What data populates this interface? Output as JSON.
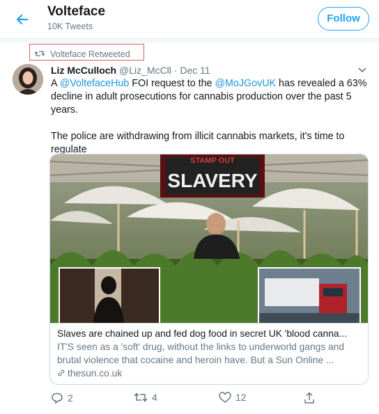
{
  "header": {
    "title": "Volteface",
    "subtitle": "10K Tweets",
    "follow_label": "Follow",
    "back_icon": "arrow-left-icon"
  },
  "retweet_context": "Volteface Retweeted",
  "tweet": {
    "author_name": "Liz McCulloch",
    "author_handle": "@Liz_McCll",
    "separator": "·",
    "date": "Dec 11",
    "text": {
      "p1_before": "A ",
      "mention1": "@VoltefaceHub",
      "p1_mid": " FOI request to the ",
      "mention2": "@MoJGovUK",
      "p1_after": " has revealed a 63% decline in adult prosecutions for cannabis production over the past 5 years.",
      "p2": "The police are withdrawing from illicit cannabis markets, it's time to regulate"
    }
  },
  "card": {
    "image_sign": "SLAVERY",
    "image_sign_top": "STAMP OUT",
    "title": "Slaves are chained up and fed dog food in secret UK 'blood canna...",
    "description": "IT'S seen as a 'soft' drug, without the links to underworld gangs and brutal violence that cocaine and heroin have. But a Sun Online ...",
    "domain": "thesun.co.uk"
  },
  "actions": {
    "reply_count": "2",
    "retweet_count": "4",
    "like_count": "12"
  },
  "colors": {
    "accent": "#1da1f2",
    "mention": "#1b95e0",
    "secondary_text": "#657786",
    "highlight_box": "#e05a5a"
  }
}
